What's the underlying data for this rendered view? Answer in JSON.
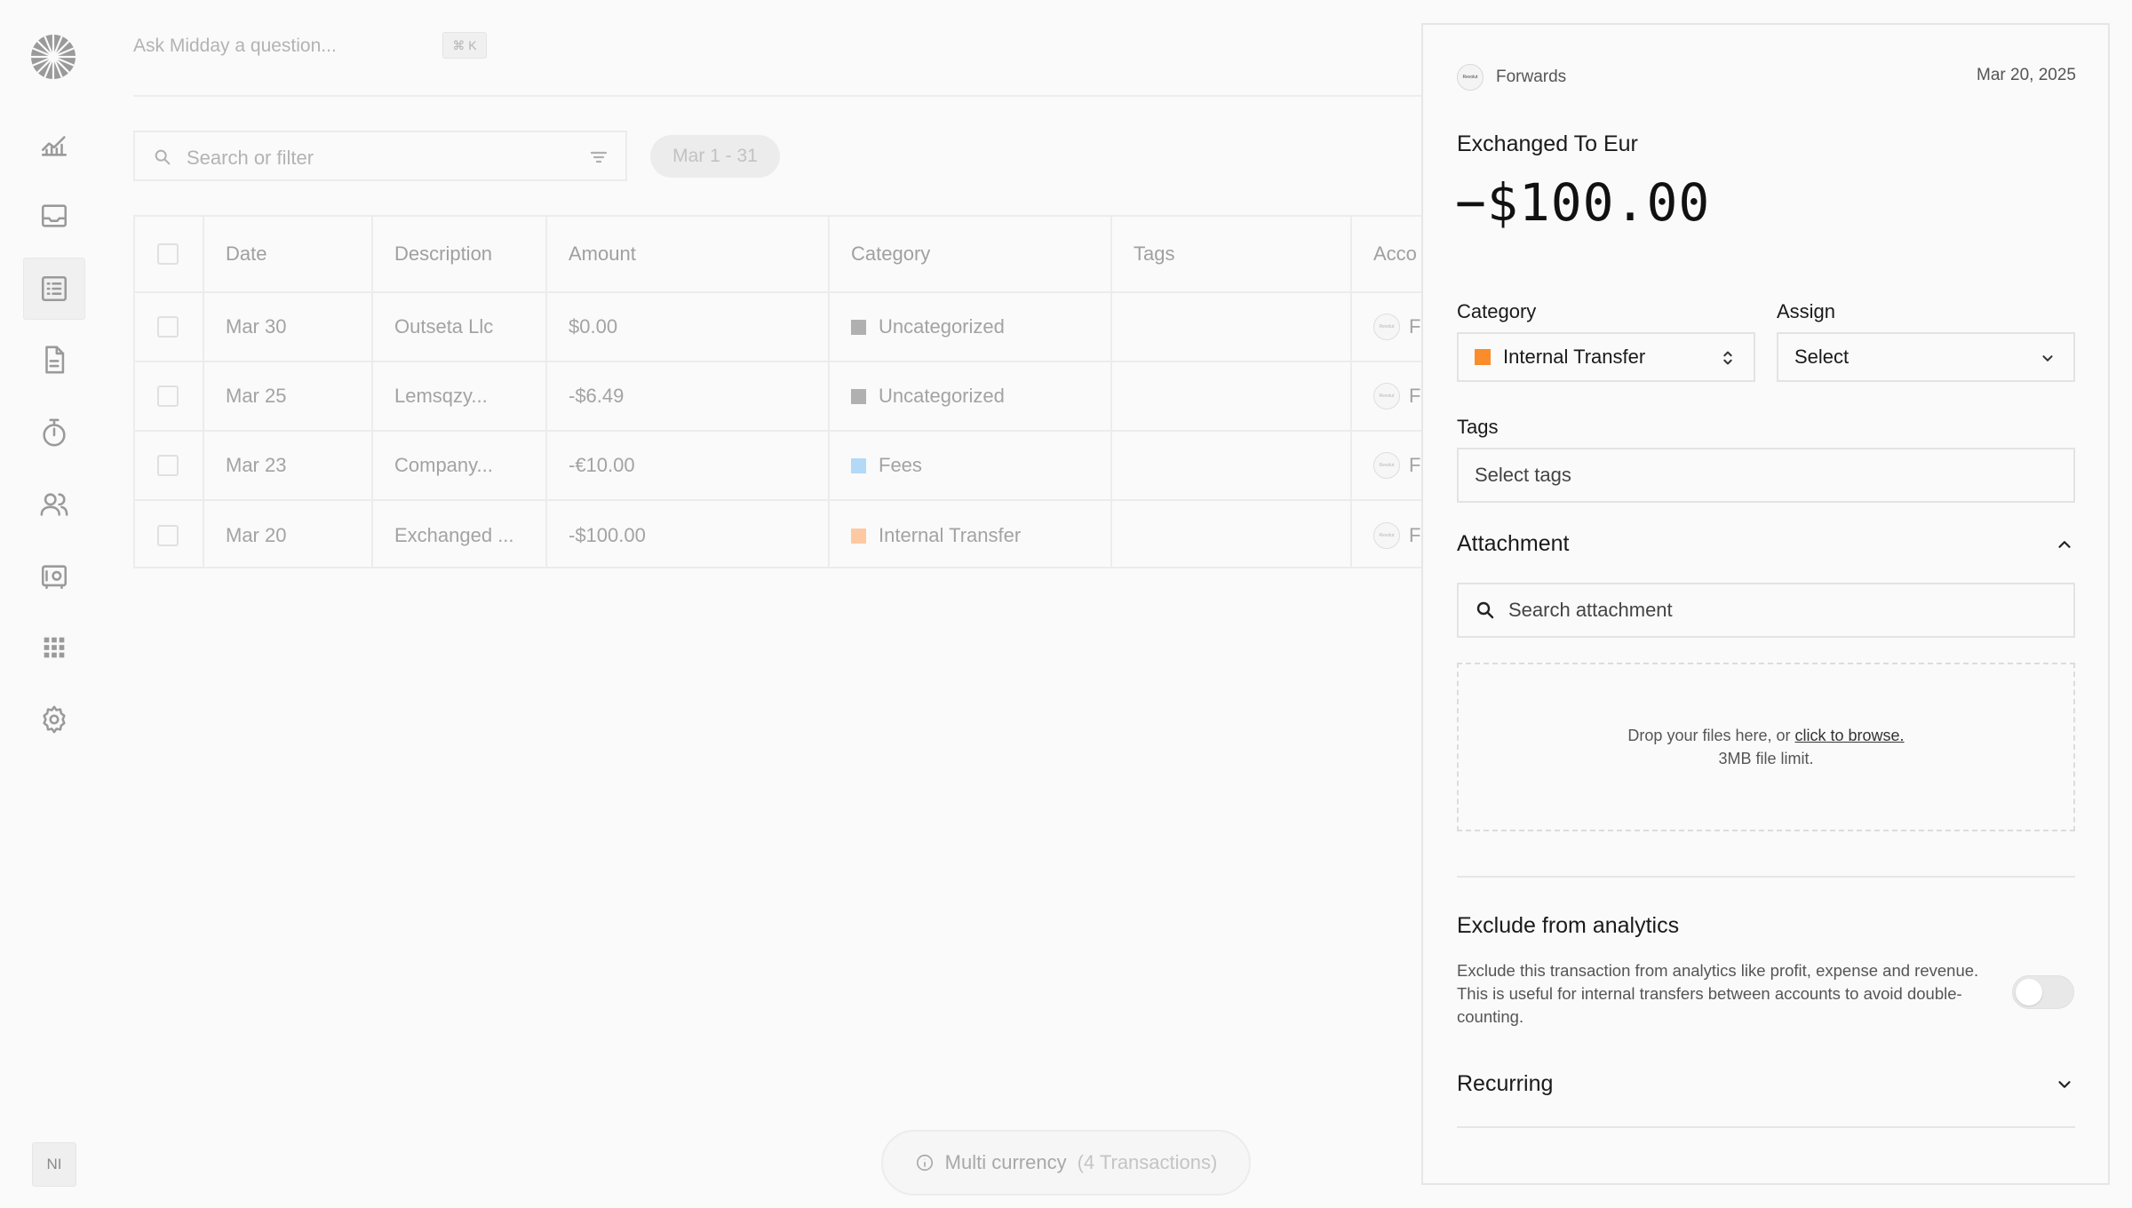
{
  "header": {
    "ask_placeholder": "Ask Midday a question...",
    "shortcut": "⌘ K"
  },
  "sidebar": {
    "items": [
      {
        "name": "overview",
        "icon": "chart-icon"
      },
      {
        "name": "inbox",
        "icon": "inbox-icon"
      },
      {
        "name": "transactions",
        "icon": "list-icon",
        "active": true
      },
      {
        "name": "invoices",
        "icon": "document-icon"
      },
      {
        "name": "tracker",
        "icon": "timer-icon"
      },
      {
        "name": "customers",
        "icon": "users-icon"
      },
      {
        "name": "vault",
        "icon": "vault-icon"
      },
      {
        "name": "apps",
        "icon": "grid-icon"
      },
      {
        "name": "settings",
        "icon": "gear-icon"
      }
    ],
    "avatar_initials": "NI"
  },
  "toolbar": {
    "search_placeholder": "Search or filter",
    "date_range": "Mar 1 - 31"
  },
  "table": {
    "columns": [
      "Date",
      "Description",
      "Amount",
      "Category",
      "Tags",
      "Acco"
    ],
    "rows": [
      {
        "date": "Mar 30",
        "description": "Outseta Llc",
        "amount": "$0.00",
        "category": "Uncategorized",
        "category_color": "#b0b0b0",
        "account": "F",
        "logo": "Revolut"
      },
      {
        "date": "Mar 25",
        "description": "Lemsqzy...",
        "amount": "-$6.49",
        "category": "Uncategorized",
        "category_color": "#b0b0b0",
        "account": "F",
        "logo": "Revolut"
      },
      {
        "date": "Mar 23",
        "description": "Company...",
        "amount": "-€10.00",
        "category": "Fees",
        "category_color": "#b3d9f7",
        "account": "F",
        "logo": "Revolut"
      },
      {
        "date": "Mar 20",
        "description": "Exchanged ...",
        "amount": "-$100.00",
        "category": "Internal Transfer",
        "category_color": "#fcc9a3",
        "account": "F",
        "logo": "Revolut"
      }
    ]
  },
  "bottom_bar": {
    "label": "Multi currency",
    "count": "(4 Transactions)"
  },
  "detail": {
    "account_logo": "Revolut",
    "account_name": "Forwards",
    "date": "Mar 20, 2025",
    "title": "Exchanged To Eur",
    "amount": "−$100.00",
    "category_label": "Category",
    "category_value": "Internal Transfer",
    "category_color": "#fa8c2a",
    "assign_label": "Assign",
    "assign_value": "Select",
    "tags_label": "Tags",
    "tags_placeholder": "Select tags",
    "attachment_title": "Attachment",
    "attachment_search": "Search attachment",
    "drop_text": "Drop your files here, or",
    "drop_link": "click to browse.",
    "drop_limit": "3MB file limit.",
    "exclude_title": "Exclude from analytics",
    "exclude_desc": "Exclude this transaction from analytics like profit, expense and revenue. This is useful for internal transfers between accounts to avoid double-counting.",
    "exclude_enabled": false,
    "recurring_title": "Recurring"
  }
}
